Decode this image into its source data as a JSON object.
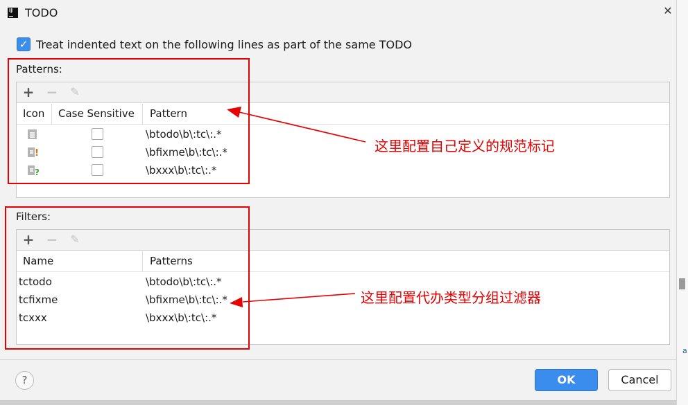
{
  "window": {
    "title": "TODO",
    "app_icon_text": "IJ",
    "close_icon": "close-icon"
  },
  "checkbox": {
    "checked": true,
    "label": "Treat indented text on the following lines as part of the same TODO"
  },
  "patterns": {
    "label": "Patterns:",
    "toolbar": {
      "add": "+",
      "remove": "−",
      "edit": "✎"
    },
    "columns": [
      "Icon",
      "Case Sensitive",
      "Pattern"
    ],
    "rows": [
      {
        "icon": "todo-default-icon",
        "case_sensitive": false,
        "pattern": "\\btodo\\b\\:tc\\:.*"
      },
      {
        "icon": "todo-important-icon",
        "case_sensitive": false,
        "pattern": "\\bfixme\\b\\:tc\\:.*"
      },
      {
        "icon": "todo-question-icon",
        "case_sensitive": false,
        "pattern": "\\bxxx\\b\\:tc\\:.*"
      }
    ]
  },
  "filters": {
    "label": "Filters:",
    "toolbar": {
      "add": "+",
      "remove": "−",
      "edit": "✎"
    },
    "columns": [
      "Name",
      "Patterns"
    ],
    "rows": [
      {
        "name": "tctodo",
        "patterns": "\\btodo\\b\\:tc\\:.*"
      },
      {
        "name": "tcfixme",
        "patterns": "\\bfixme\\b\\:tc\\:.*"
      },
      {
        "name": "tcxxx",
        "patterns": "\\bxxx\\b\\:tc\\:.*"
      }
    ]
  },
  "annotations": {
    "patterns_note": "这里配置自己定义的规范标记",
    "filters_note": "这里配置代办类型分组过滤器",
    "color": "#e60000"
  },
  "footer": {
    "help": "?",
    "ok": "OK",
    "cancel": "Cancel"
  },
  "colors": {
    "accent": "#3a8ded",
    "annotation": "#e60000"
  }
}
